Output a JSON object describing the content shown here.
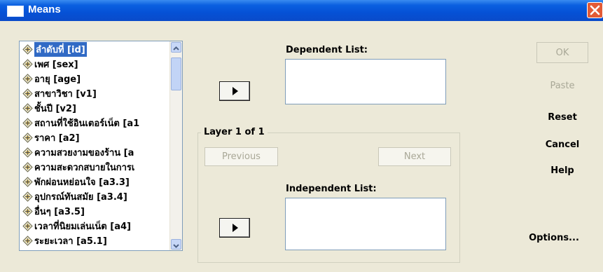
{
  "window": {
    "title": "Means"
  },
  "variables": [
    "ลำดับที่ [id]",
    "เพศ [sex]",
    "อายุ [age]",
    "สาขาวิชา [v1]",
    "ชั้นปี [v2]",
    "สถานที่ใช้อินเตอร์เน็ต [a1",
    "ราคา [a2]",
    "ความสวยงามของร้าน [a",
    "ความสะดวกสบายในการเ",
    "พักผ่อนหย่อนใจ [a3.3]",
    "อุปกรณ์ทันสมัย [a3.4]",
    "อื่นๆ [a3.5]",
    "เวลาที่นิยมเล่นเน็ต [a4]",
    "ระยะเวลา [a5.1]"
  ],
  "dependent": {
    "label": "Dependent List:"
  },
  "independent": {
    "label": "Independent List:"
  },
  "layer": {
    "label": "Layer 1 of 1",
    "previous": "Previous",
    "next": "Next"
  },
  "buttons": {
    "ok": "OK",
    "paste": "Paste",
    "reset": "Reset",
    "cancel": "Cancel",
    "help": "Help",
    "options": "Options..."
  },
  "icons": {
    "title": "window-icon",
    "close": "close-icon",
    "variable": "scale-variable-icon",
    "arrow": "arrow-right-icon"
  },
  "colors": {
    "titlebar": "#0551d6",
    "selection": "#316ac5",
    "close": "#e35a35"
  }
}
